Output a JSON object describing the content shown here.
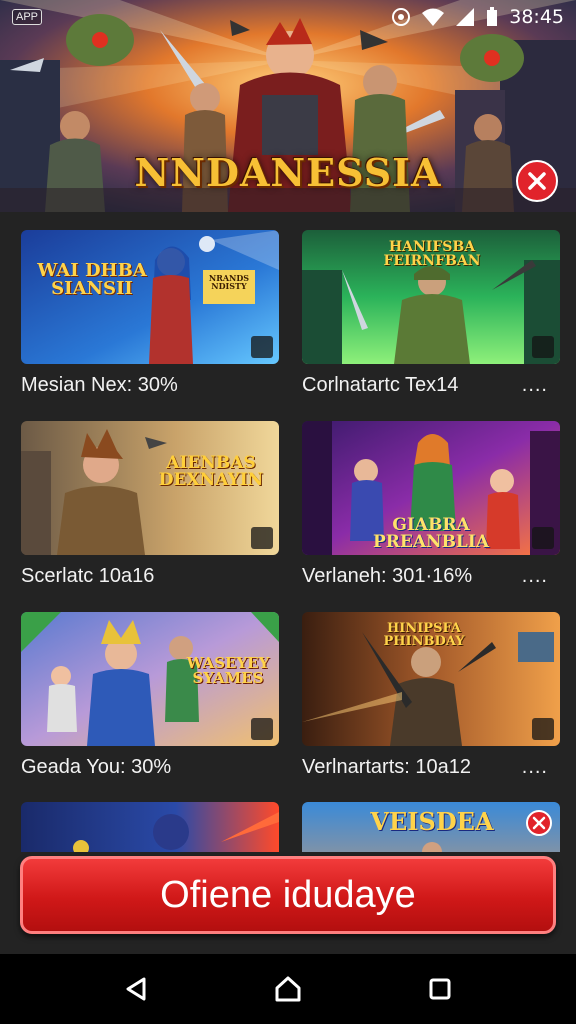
{
  "status_bar": {
    "app_chip": "APP",
    "time": "38:45"
  },
  "hero": {
    "title": "NNDANESSIA"
  },
  "cards": [
    {
      "caption": "Mesian Nex: 30%",
      "art_text": "WAI DHBA SIANSII",
      "sign_text": "NRANDS NDISTY",
      "more": "...."
    },
    {
      "caption": "Corlnatartc Tex14",
      "art_text": "HANIFSBA FEIRNFBAN",
      "more": "...."
    },
    {
      "caption": "Scerlatc 10a16",
      "art_text": "AIENBAS DEXNAYIN",
      "more": ""
    },
    {
      "caption": "Verlaneh: 301·16%",
      "art_text": "GIABRA PREANBLIA",
      "more": "...."
    },
    {
      "caption": "Geada You: 30%",
      "art_text": "WASEYEY SYAMES",
      "more": ""
    },
    {
      "caption": "Verlnartarts: 10a12",
      "art_text": "HINIPSFA PHINBDAY",
      "more": "...."
    },
    {
      "caption": "",
      "art_text": "",
      "more": ""
    },
    {
      "caption": "",
      "art_text": "VEISDEA",
      "more": ""
    }
  ],
  "cta": {
    "label": "Ofiene idudaye"
  },
  "icons": [
    "cast-icon",
    "wifi-icon",
    "signal-icon",
    "battery-icon",
    "close-icon",
    "lock-icon",
    "back-icon",
    "home-icon",
    "recents-icon"
  ],
  "colors": {
    "accent_red": "#e1232b",
    "title_gold": "#f7c035",
    "background": "#232323"
  }
}
